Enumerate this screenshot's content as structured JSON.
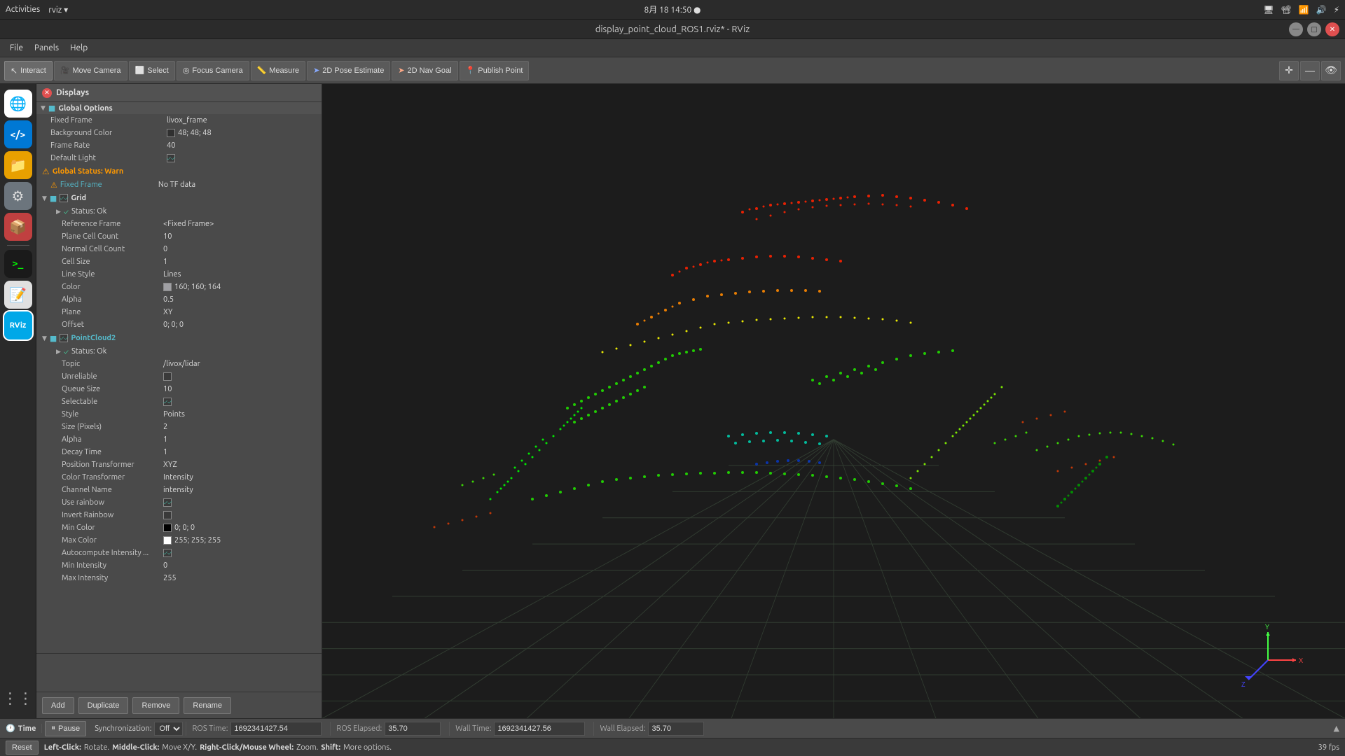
{
  "system_bar": {
    "activities": "Activities",
    "app": "rviz ▾",
    "clock": "8月 18  14:50  ●",
    "record_icon": "⏺",
    "net_icon": "▲",
    "vol_icon": "🔊",
    "pwr_icon": "⚡"
  },
  "title_bar": {
    "title": "display_point_cloud_ROS1.rviz* - RViz",
    "minimize": "—",
    "maximize": "□",
    "close": "✕"
  },
  "menu": {
    "items": [
      "File",
      "Panels",
      "Help"
    ]
  },
  "toolbar": {
    "interact": "Interact",
    "move_camera": "Move Camera",
    "select": "Select",
    "focus_camera": "Focus Camera",
    "measure": "Measure",
    "pose_estimate": "2D Pose Estimate",
    "nav_goal": "2D Nav Goal",
    "publish_point": "Publish Point"
  },
  "displays_panel": {
    "title": "Displays",
    "global_options": "Global Options",
    "fixed_frame_label": "Fixed Frame",
    "fixed_frame_value": "livox_frame",
    "bg_color_label": "Background Color",
    "bg_color_value": "48; 48; 48",
    "frame_rate_label": "Frame Rate",
    "frame_rate_value": "40",
    "default_light_label": "Default Light",
    "default_light_checked": true,
    "global_status_label": "Global Status: Warn",
    "fixed_frame_warn_label": "Fixed Frame",
    "fixed_frame_warn_value": "No TF data",
    "grid_label": "Grid",
    "grid_checked": true,
    "status_ok": "Status: Ok",
    "ref_frame_label": "Reference Frame",
    "ref_frame_value": "<Fixed Frame>",
    "plane_cell_count_label": "Plane Cell Count",
    "plane_cell_count_value": "10",
    "normal_cell_count_label": "Normal Cell Count",
    "normal_cell_count_value": "0",
    "cell_size_label": "Cell Size",
    "cell_size_value": "1",
    "line_style_label": "Line Style",
    "line_style_value": "Lines",
    "color_label": "Color",
    "color_value": "160; 160; 164",
    "alpha_label": "Alpha",
    "alpha_value": "0.5",
    "plane_label": "Plane",
    "plane_value": "XY",
    "offset_label": "Offset",
    "offset_value": "0; 0; 0",
    "pointcloud2_label": "PointCloud2",
    "pointcloud2_checked": true,
    "pc_status_ok": "Status: Ok",
    "topic_label": "Topic",
    "topic_value": "/livox/lidar",
    "unreliable_label": "Unreliable",
    "unreliable_checked": false,
    "queue_size_label": "Queue Size",
    "queue_size_value": "10",
    "selectable_label": "Selectable",
    "selectable_checked": true,
    "style_label": "Style",
    "style_value": "Points",
    "size_pixels_label": "Size (Pixels)",
    "size_pixels_value": "2",
    "alpha2_label": "Alpha",
    "alpha2_value": "1",
    "decay_time_label": "Decay Time",
    "decay_time_value": "1",
    "position_transformer_label": "Position Transformer",
    "position_transformer_value": "XYZ",
    "color_transformer_label": "Color Transformer",
    "color_transformer_value": "Intensity",
    "channel_name_label": "Channel Name",
    "channel_name_value": "intensity",
    "use_rainbow_label": "Use rainbow",
    "use_rainbow_checked": true,
    "invert_rainbow_label": "Invert Rainbow",
    "invert_rainbow_checked": false,
    "min_color_label": "Min Color",
    "min_color_value": "0; 0; 0",
    "max_color_label": "Max Color",
    "max_color_value": "255; 255; 255",
    "autocompute_label": "Autocompute Intensity ...",
    "autocompute_checked": true,
    "min_intensity_label": "Min Intensity",
    "min_intensity_value": "0",
    "max_intensity_label": "Max Intensity",
    "max_intensity_value": "255"
  },
  "buttons": {
    "add": "Add",
    "duplicate": "Duplicate",
    "remove": "Remove",
    "rename": "Rename"
  },
  "time_panel": {
    "title": "Time",
    "pause_label": "Pause",
    "sync_label": "Synchronization:",
    "sync_value": "Off",
    "ros_time_label": "ROS Time:",
    "ros_time_value": "1692341427.54",
    "ros_elapsed_label": "ROS Elapsed:",
    "ros_elapsed_value": "35.70",
    "wall_time_label": "Wall Time:",
    "wall_time_value": "1692341427.56",
    "wall_elapsed_label": "Wall Elapsed:",
    "wall_elapsed_value": "35.70"
  },
  "status_bar": {
    "reset": "Reset",
    "left_click": "Left-Click:",
    "left_click_action": "Rotate.",
    "middle_click": "Middle-Click:",
    "middle_click_action": "Move X/Y.",
    "right_click": "Right-Click/Mouse Wheel:",
    "right_click_action": "Zoom.",
    "shift": "Shift:",
    "shift_action": "More options.",
    "fps": "39 fps"
  },
  "dock": {
    "icons": [
      {
        "name": "chrome",
        "label": "🌐",
        "bg": "#fff"
      },
      {
        "name": "vscode",
        "label": "</>",
        "bg": "#0078d4"
      },
      {
        "name": "files",
        "label": "📁",
        "bg": "#e8a000"
      },
      {
        "name": "settings",
        "label": "⚙",
        "bg": "#6c757d"
      },
      {
        "name": "synaptic",
        "label": "📦",
        "bg": "#d04040"
      },
      {
        "name": "terminal",
        "label": ">_",
        "bg": "#1a1a1a"
      },
      {
        "name": "gedit",
        "label": "📝",
        "bg": "#e8e8e8"
      },
      {
        "name": "rviz",
        "label": "RViz",
        "bg": "#00a8e8"
      }
    ]
  }
}
